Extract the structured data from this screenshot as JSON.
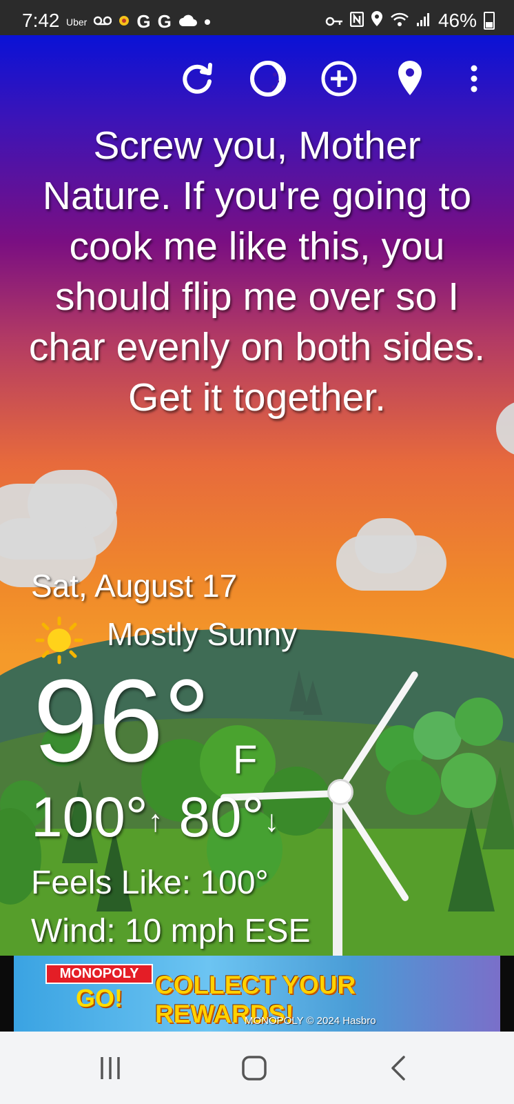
{
  "status_bar": {
    "time": "7:42",
    "notif_uber": "Uber",
    "notif_google_1": "G",
    "notif_google_2": "G",
    "battery": "46%"
  },
  "toolbar": {
    "icons": [
      "refresh-icon",
      "moon-icon",
      "add-icon",
      "location-icon",
      "more-vert-icon"
    ]
  },
  "quote": "Screw you, Mother Nature. If you're going to cook me like this, you should flip me over so I char evenly on both sides. Get it together.",
  "weather": {
    "date": "Sat, August 17",
    "condition": "Mostly Sunny",
    "condition_icon": "sun-icon",
    "temperature": "96°",
    "unit": "F",
    "high": "100°",
    "low": "80°",
    "feels_like": "Feels Like:  100°",
    "wind": "Wind:  10 mph ESE"
  },
  "ad": {
    "logo_top": "MONOPOLY",
    "logo_bottom": "GO!",
    "cta": "COLLECT YOUR REWARDS!",
    "copyright": "MONOPOLY © 2024 Hasbro"
  },
  "nav": {
    "icons": [
      "recent-apps-icon",
      "home-icon",
      "back-icon"
    ]
  },
  "colors": {
    "sky_top": "#0a12d6",
    "sky_mid": "#7a0f82",
    "sky_bottom": "#f59a2a",
    "grass": "#569e2b",
    "ad_cta": "#ffd200"
  }
}
